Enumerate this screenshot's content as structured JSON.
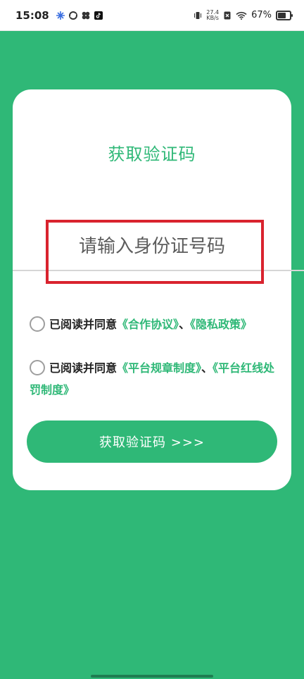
{
  "status_bar": {
    "time": "15:08",
    "speed_value": "27.4",
    "speed_unit": "KB/s",
    "battery_percent": "67%",
    "battery_level": 0.67
  },
  "form": {
    "title": "获取验证码",
    "id_input_placeholder": "请输入身份证号码",
    "id_input_value": "",
    "agreement_1": {
      "prefix": "已阅读并同意",
      "link_1": "《合作协议》",
      "separator": "、",
      "link_2": "《隐私政策》"
    },
    "agreement_2": {
      "prefix": "已阅读并同意",
      "link_1": "《平台规章制度》",
      "separator": "、",
      "link_2": "《平台红线处罚制度》"
    },
    "submit_label": "获取验证码 >>>"
  },
  "colors": {
    "brand_green": "#2fb877",
    "highlight_red": "#d9232e"
  }
}
